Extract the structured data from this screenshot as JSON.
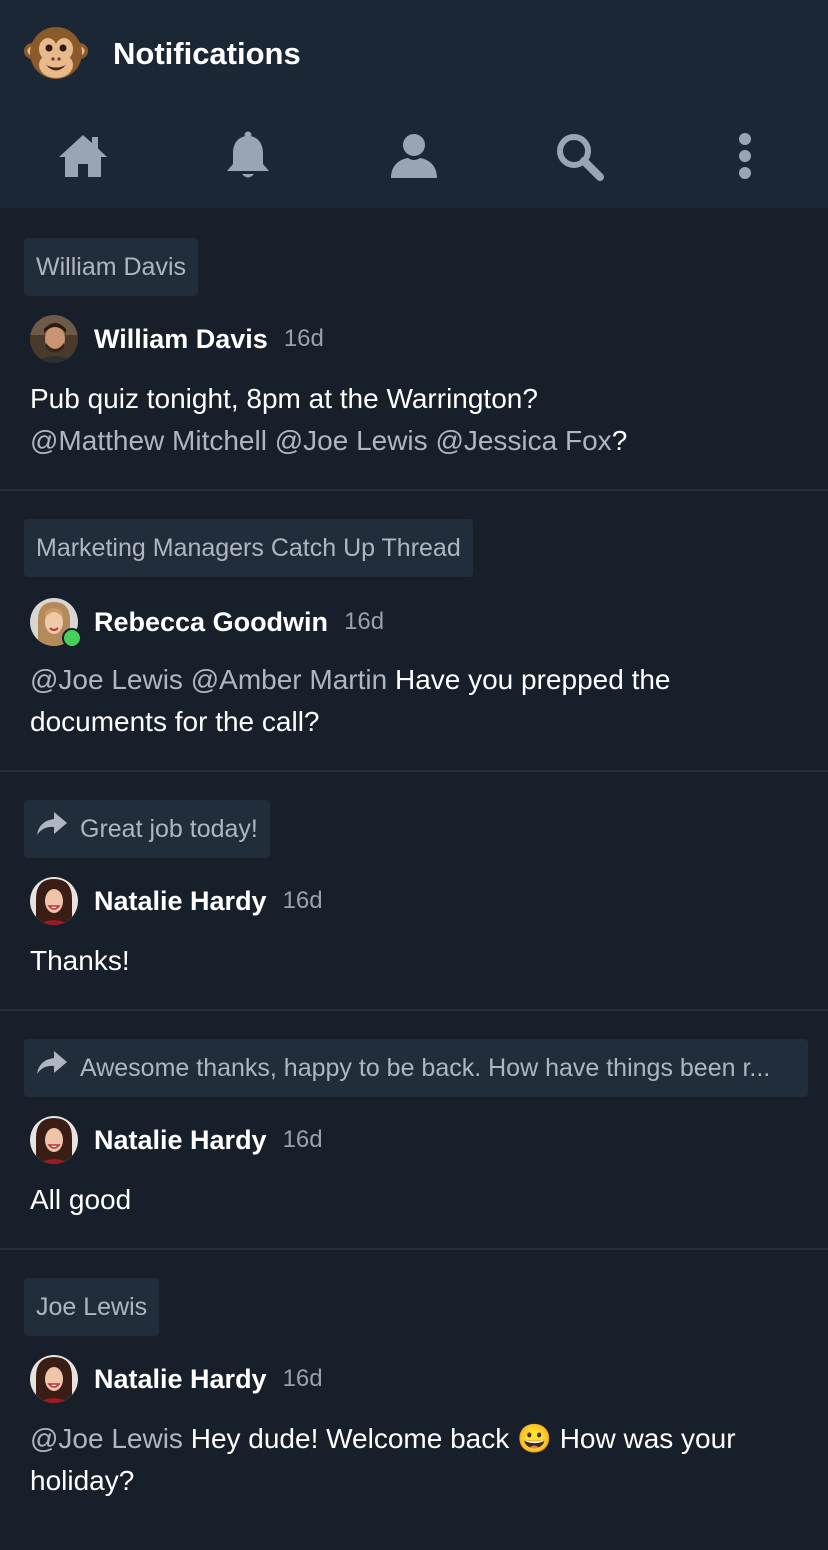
{
  "header": {
    "title": "Notifications"
  },
  "nav": [
    {
      "icon": "home-icon"
    },
    {
      "icon": "bell-icon"
    },
    {
      "icon": "user-icon"
    },
    {
      "icon": "search-icon"
    },
    {
      "icon": "more-vertical-icon"
    }
  ],
  "items": [
    {
      "context": "William Davis",
      "author": "William Davis",
      "time": "16d",
      "message": {
        "text1": "Pub quiz tonight, 8pm at the Warrington?",
        "mention1": "@Matthew Mitchell",
        "mention2": "@Joe Lewis",
        "mention3": "@Jessica Fox",
        "text2": "?"
      }
    },
    {
      "context": "Marketing Managers Catch Up Thread",
      "author": "Rebecca Goodwin",
      "time": "16d",
      "message": {
        "mention1": "@Joe Lewis",
        "mention2": "@Amber Martin",
        "text1": "Have you prepped the documents for the call?"
      }
    },
    {
      "context": "Great job today!",
      "author": "Natalie Hardy",
      "time": "16d",
      "message": {
        "text1": "Thanks!"
      }
    },
    {
      "context": "Awesome thanks, happy to be back. How have things been r...",
      "author": "Natalie Hardy",
      "time": "16d",
      "message": {
        "text1": "All good"
      }
    },
    {
      "context": "Joe Lewis",
      "author": "Natalie Hardy",
      "time": "16d",
      "message": {
        "mention1": "@Joe Lewis",
        "text1": "Hey dude! Welcome back",
        "emoji": "😀",
        "text2": "How was your holiday?"
      }
    }
  ]
}
